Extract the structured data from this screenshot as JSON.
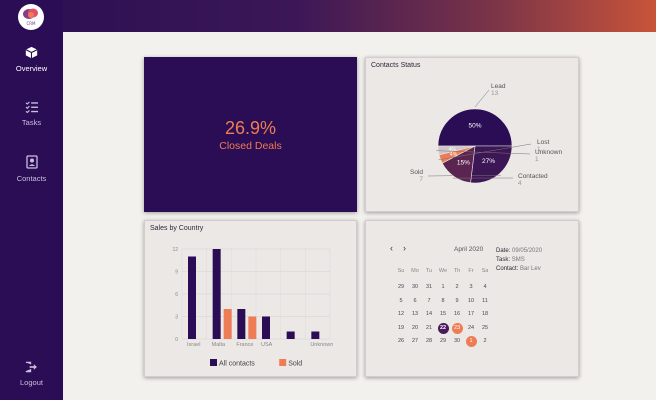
{
  "brand": {
    "logo_text": "CRM"
  },
  "nav": [
    {
      "label": "Overview",
      "icon": "cube-icon",
      "active": true
    },
    {
      "label": "Tasks",
      "icon": "checklist-icon",
      "active": false
    },
    {
      "label": "Contacts",
      "icon": "contact-card-icon",
      "active": false
    }
  ],
  "logout": {
    "label": "Logout",
    "icon": "logout-icon"
  },
  "kpi": {
    "value": "26.9%",
    "label": "Closed Deals"
  },
  "contacts_status": {
    "title": "Contacts Status",
    "chart_data": {
      "type": "pie",
      "slices": [
        {
          "label": "Lead",
          "value": 13,
          "percent_label": "50%",
          "color": "#2b0d55"
        },
        {
          "label": "Sold",
          "value": 7,
          "percent_label": "27%",
          "color": "#3d1656"
        },
        {
          "label": "Contacted",
          "value": 4,
          "percent_label": "15%",
          "color": "#5a2550"
        },
        {
          "label": "Lost",
          "value": 1,
          "percent_label": "4%",
          "color": "#ee7c55"
        },
        {
          "label": "Unknown",
          "value": 1,
          "percent_label": "4%",
          "color": "#d0c7cc"
        }
      ]
    }
  },
  "sales_by_country": {
    "title": "Sales by Country",
    "chart_data": {
      "type": "bar",
      "categories": [
        "Israel",
        "Malta",
        "France",
        "USA",
        "",
        "Unknown"
      ],
      "series": [
        {
          "name": "All contacts",
          "values": [
            11,
            598,
            4,
            3,
            1,
            1
          ],
          "color": "#2b0d55"
        },
        {
          "name": "Sold",
          "values": [
            0,
            4,
            3,
            0,
            0,
            0
          ],
          "color": "#ee7c55"
        }
      ],
      "y_ticks": [
        "0",
        "3",
        "6",
        "9",
        "12"
      ],
      "ylim": [
        0,
        12
      ],
      "legend_position": "bottom"
    }
  },
  "calendar": {
    "prev": "‹",
    "next": "›",
    "month_label": "April 2020",
    "weekdays": [
      "Su",
      "Mo",
      "Tu",
      "We",
      "Th",
      "Fr",
      "Sa"
    ],
    "weeks": [
      [
        "29",
        "30",
        "31",
        "1",
        "2",
        "3",
        "4"
      ],
      [
        "5",
        "6",
        "7",
        "8",
        "9",
        "10",
        "11"
      ],
      [
        "12",
        "13",
        "14",
        "15",
        "16",
        "17",
        "18"
      ],
      [
        "19",
        "20",
        "21",
        "22",
        "23",
        "24",
        "25"
      ],
      [
        "26",
        "27",
        "28",
        "29",
        "30",
        "1",
        "2"
      ]
    ],
    "event": {
      "date_label": "Date:",
      "date_value": "09/05/2020",
      "task_label": "Task:",
      "task_value": "SMS",
      "contact_label": "Contact:",
      "contact_value": "Bar Lev"
    }
  }
}
